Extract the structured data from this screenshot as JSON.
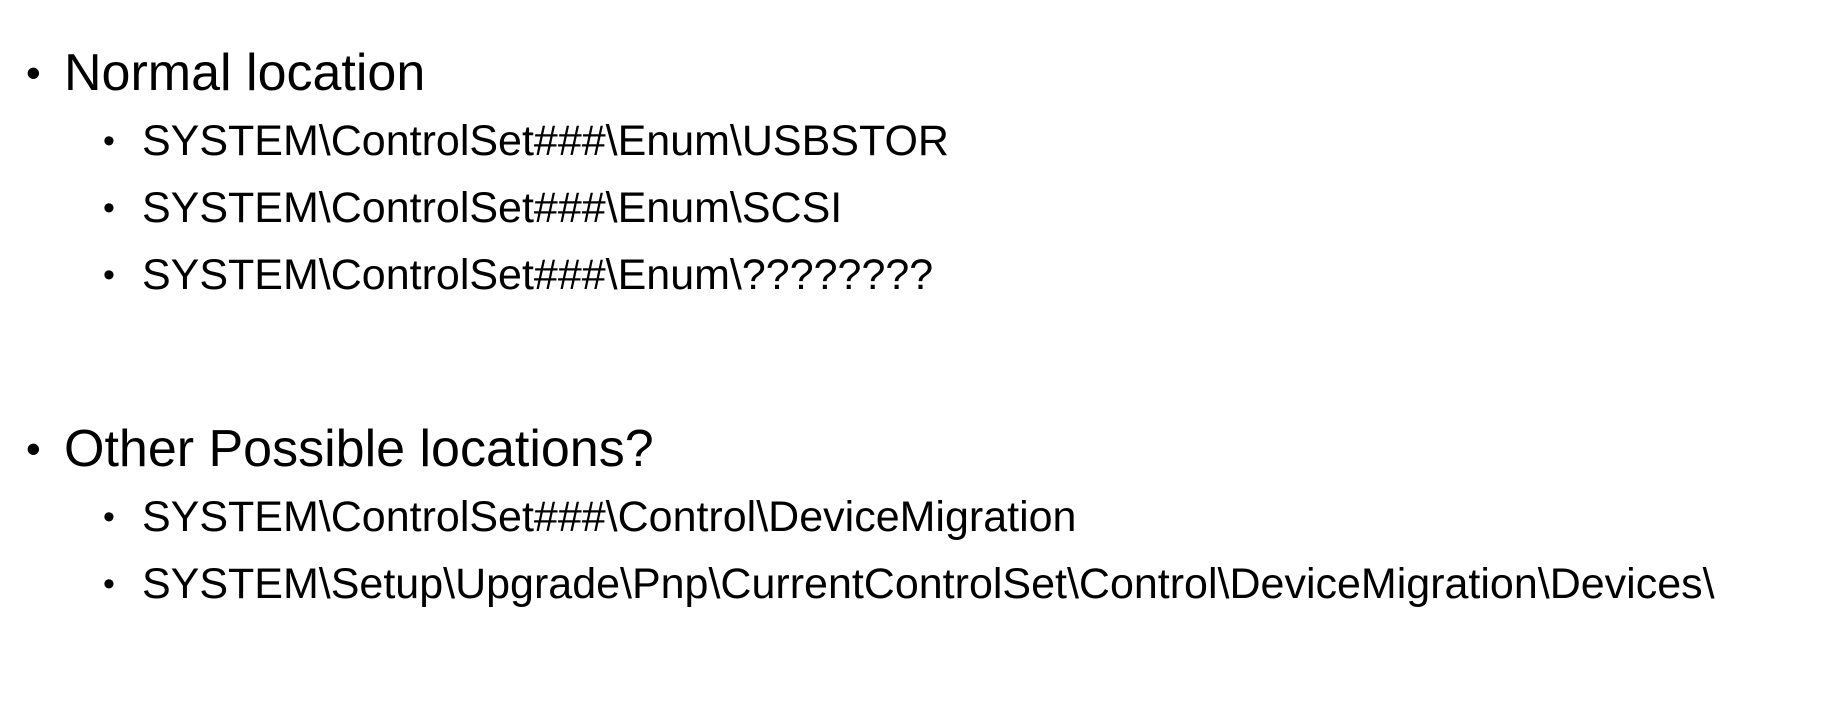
{
  "sections": [
    {
      "heading": "Normal location",
      "items": [
        "SYSTEM\\ControlSet###\\Enum\\USBSTOR",
        "SYSTEM\\ControlSet###\\Enum\\SCSI",
        "SYSTEM\\ControlSet###\\Enum\\????????"
      ]
    },
    {
      "heading": "Other Possible locations?",
      "items": [
        "SYSTEM\\ControlSet###\\Control\\DeviceMigration",
        "SYSTEM\\Setup\\Upgrade\\Pnp\\CurrentControlSet\\Control\\DeviceMigration\\Devices\\"
      ]
    }
  ],
  "bullet_glyph": "•"
}
